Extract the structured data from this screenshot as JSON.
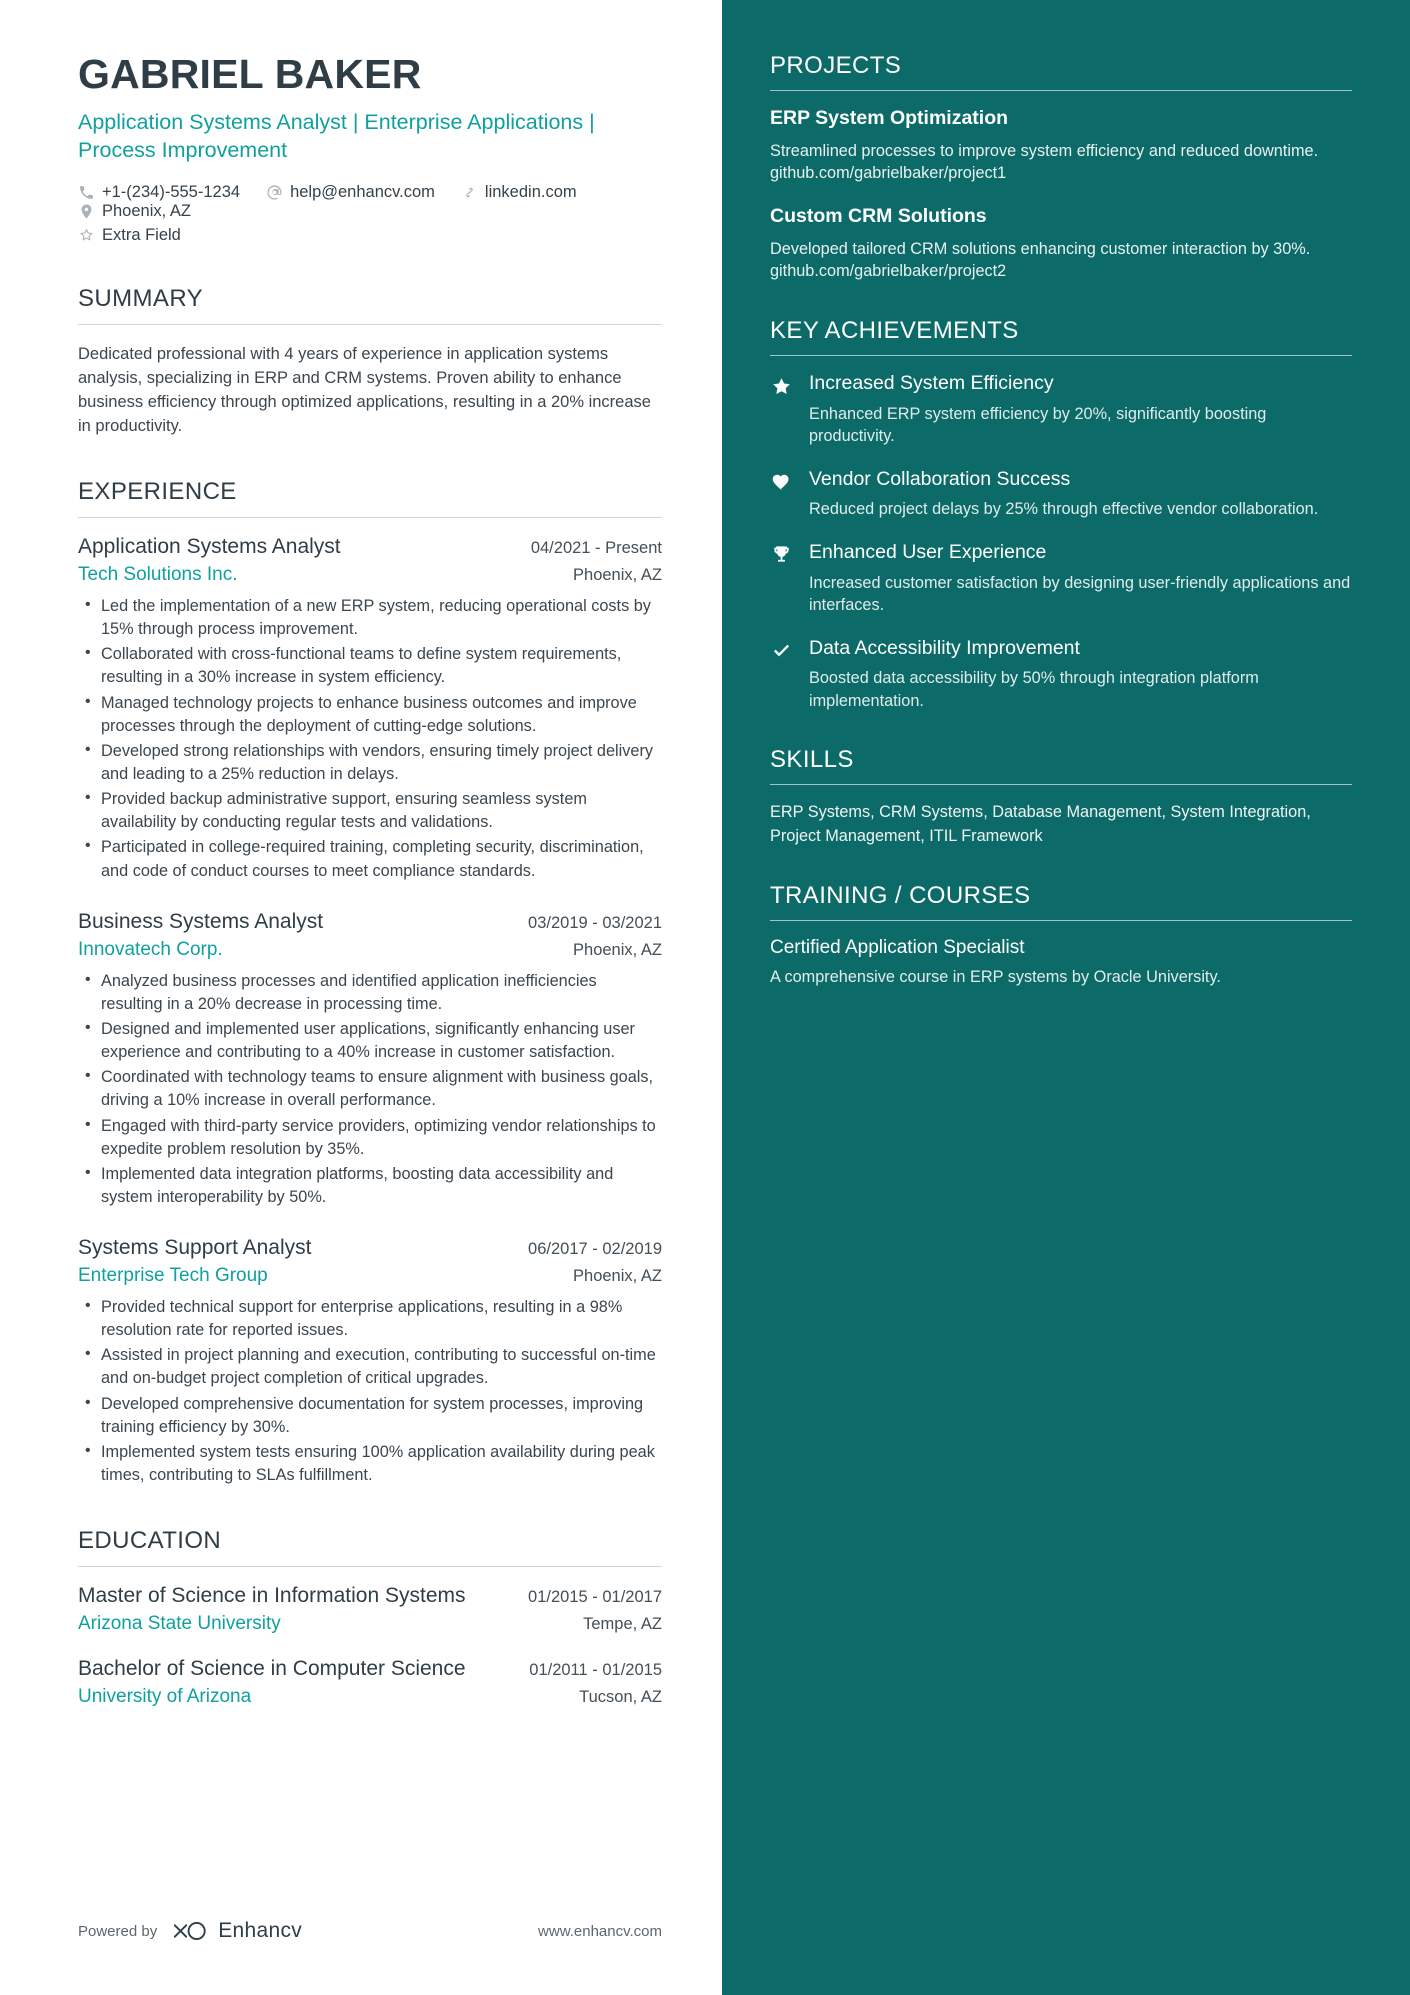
{
  "theme": {
    "accent": "#10a0a0",
    "sidebar_bg": "#0c6b68",
    "heading": "#2f3e46"
  },
  "header": {
    "name": "GABRIEL BAKER",
    "headline": "Application Systems Analyst | Enterprise Applications | Process Improvement",
    "contacts": [
      {
        "icon": "phone-icon",
        "text": "+1-(234)-555-1234"
      },
      {
        "icon": "email-icon",
        "text": "help@enhancv.com"
      },
      {
        "icon": "link-icon",
        "text": "linkedin.com"
      },
      {
        "icon": "location-pin-icon",
        "text": "Phoenix, AZ"
      }
    ],
    "extra": {
      "icon": "star-outline-icon",
      "text": "Extra Field"
    }
  },
  "summary": {
    "title": "SUMMARY",
    "text": "Dedicated professional with 4 years of experience in application systems analysis, specializing in ERP and CRM systems. Proven ability to enhance business efficiency through optimized applications, resulting in a 20% increase in productivity."
  },
  "experience": {
    "title": "EXPERIENCE",
    "jobs": [
      {
        "title": "Application Systems Analyst",
        "date": "04/2021 - Present",
        "company": "Tech Solutions Inc.",
        "location": "Phoenix, AZ",
        "bullets": [
          "Led the implementation of a new ERP system, reducing operational costs by 15% through process improvement.",
          "Collaborated with cross-functional teams to define system requirements, resulting in a 30% increase in system efficiency.",
          "Managed technology projects to enhance business outcomes and improve processes through the deployment of cutting-edge solutions.",
          "Developed strong relationships with vendors, ensuring timely project delivery and leading to a 25% reduction in delays.",
          "Provided backup administrative support, ensuring seamless system availability by conducting regular tests and validations.",
          "Participated in college-required training, completing security, discrimination, and code of conduct courses to meet compliance standards."
        ]
      },
      {
        "title": "Business Systems Analyst",
        "date": "03/2019 - 03/2021",
        "company": "Innovatech Corp.",
        "location": "Phoenix, AZ",
        "bullets": [
          "Analyzed business processes and identified application inefficiencies resulting in a 20% decrease in processing time.",
          "Designed and implemented user applications, significantly enhancing user experience and contributing to a 40% increase in customer satisfaction.",
          "Coordinated with technology teams to ensure alignment with business goals, driving a 10% increase in overall performance.",
          "Engaged with third-party service providers, optimizing vendor relationships to expedite problem resolution by 35%.",
          "Implemented data integration platforms, boosting data accessibility and system interoperability by 50%."
        ]
      },
      {
        "title": "Systems Support Analyst",
        "date": "06/2017 - 02/2019",
        "company": "Enterprise Tech Group",
        "location": "Phoenix, AZ",
        "bullets": [
          "Provided technical support for enterprise applications, resulting in a 98% resolution rate for reported issues.",
          "Assisted in project planning and execution, contributing to successful on-time and on-budget project completion of critical upgrades.",
          "Developed comprehensive documentation for system processes, improving training efficiency by 30%.",
          "Implemented system tests ensuring 100% application availability during peak times, contributing to SLAs fulfillment."
        ]
      }
    ]
  },
  "education": {
    "title": "EDUCATION",
    "items": [
      {
        "degree": "Master of Science in Information Systems",
        "date": "01/2015 - 01/2017",
        "school": "Arizona State University",
        "location": "Tempe, AZ"
      },
      {
        "degree": "Bachelor of Science in Computer Science",
        "date": "01/2011 - 01/2015",
        "school": "University of Arizona",
        "location": "Tucson, AZ"
      }
    ]
  },
  "footer": {
    "powered_label": "Powered by",
    "brand": "Enhancv",
    "site": "www.enhancv.com"
  },
  "sidebar": {
    "projects": {
      "title": "PROJECTS",
      "items": [
        {
          "name": "ERP System Optimization",
          "description": "Streamlined processes to improve system efficiency and reduced downtime.\ngithub.com/gabrielbaker/project1"
        },
        {
          "name": "Custom CRM Solutions",
          "description": "Developed tailored CRM solutions enhancing customer interaction by 30%.\ngithub.com/gabrielbaker/project2"
        }
      ]
    },
    "achievements": {
      "title": "KEY ACHIEVEMENTS",
      "items": [
        {
          "icon": "star-icon",
          "title": "Increased System Efficiency",
          "description": "Enhanced ERP system efficiency by 20%, significantly boosting productivity."
        },
        {
          "icon": "heart-icon",
          "title": "Vendor Collaboration Success",
          "description": "Reduced project delays by 25% through effective vendor collaboration."
        },
        {
          "icon": "trophy-icon",
          "title": "Enhanced User Experience",
          "description": "Increased customer satisfaction by designing user-friendly applications and interfaces."
        },
        {
          "icon": "check-icon",
          "title": "Data Accessibility Improvement",
          "description": "Boosted data accessibility by 50% through integration platform implementation."
        }
      ]
    },
    "skills": {
      "title": "SKILLS",
      "text": "ERP Systems, CRM Systems, Database Management, System Integration, Project Management, ITIL Framework"
    },
    "training": {
      "title": "TRAINING / COURSES",
      "items": [
        {
          "name": "Certified Application Specialist",
          "description": "A comprehensive course in ERP systems by Oracle University."
        }
      ]
    }
  }
}
